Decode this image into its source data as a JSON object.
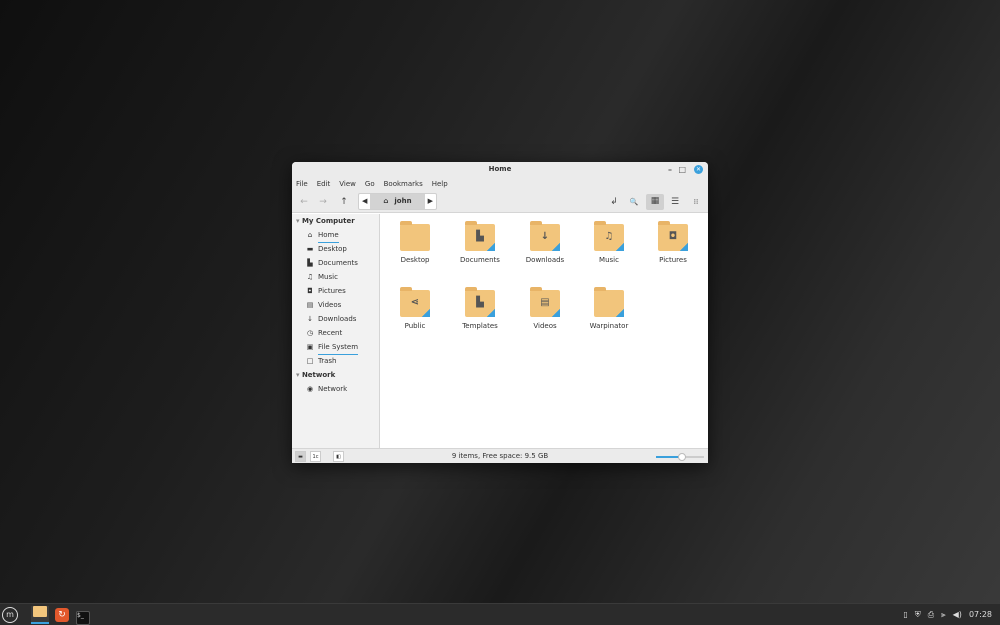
{
  "window": {
    "title": "Home",
    "minimize": "–",
    "maximize": "□",
    "close": "✕"
  },
  "menu": [
    "File",
    "Edit",
    "View",
    "Go",
    "Bookmarks",
    "Help"
  ],
  "toolbar": {
    "back": "←",
    "forward": "→",
    "up": "↑",
    "crumb_left": "◀",
    "crumb_current": "john",
    "crumb_right": "▶",
    "toggle_location": "↲",
    "search": "🔍",
    "icon_view": "▦",
    "list_view": "☰",
    "compact_view": "⁞⁞"
  },
  "sidebar": {
    "sections": [
      {
        "title": "My Computer",
        "items": [
          {
            "label": "Home",
            "icon": "⌂"
          },
          {
            "label": "Desktop",
            "icon": "▬"
          },
          {
            "label": "Documents",
            "icon": "▙"
          },
          {
            "label": "Music",
            "icon": "♫"
          },
          {
            "label": "Pictures",
            "icon": "◘"
          },
          {
            "label": "Videos",
            "icon": "▤"
          },
          {
            "label": "Downloads",
            "icon": "↓"
          },
          {
            "label": "Recent",
            "icon": "◷"
          },
          {
            "label": "File System",
            "icon": "▣"
          },
          {
            "label": "Trash",
            "icon": "□"
          }
        ]
      },
      {
        "title": "Network",
        "items": [
          {
            "label": "Network",
            "icon": "◉"
          }
        ]
      }
    ]
  },
  "files": [
    {
      "name": "Desktop",
      "emblem": ""
    },
    {
      "name": "Documents",
      "emblem": "▙"
    },
    {
      "name": "Downloads",
      "emblem": "↓"
    },
    {
      "name": "Music",
      "emblem": "♫"
    },
    {
      "name": "Pictures",
      "emblem": "◘"
    },
    {
      "name": "Public",
      "emblem": "⋖"
    },
    {
      "name": "Templates",
      "emblem": "▙"
    },
    {
      "name": "Videos",
      "emblem": "▤"
    },
    {
      "name": "Warpinator",
      "emblem": ""
    }
  ],
  "status": {
    "text": "9 items, Free space: 9.5 GB",
    "zoom_percent": 55,
    "btn_places": "▬",
    "btn_tree": "1c",
    "btn_sidebar": "◧"
  },
  "panel": {
    "menu": "⓶",
    "apps": [
      "files",
      "software-manager",
      "terminal"
    ],
    "clock": "07:28"
  },
  "colors": {
    "accent": "#3aa0dc",
    "folder": "#f2c57c"
  }
}
